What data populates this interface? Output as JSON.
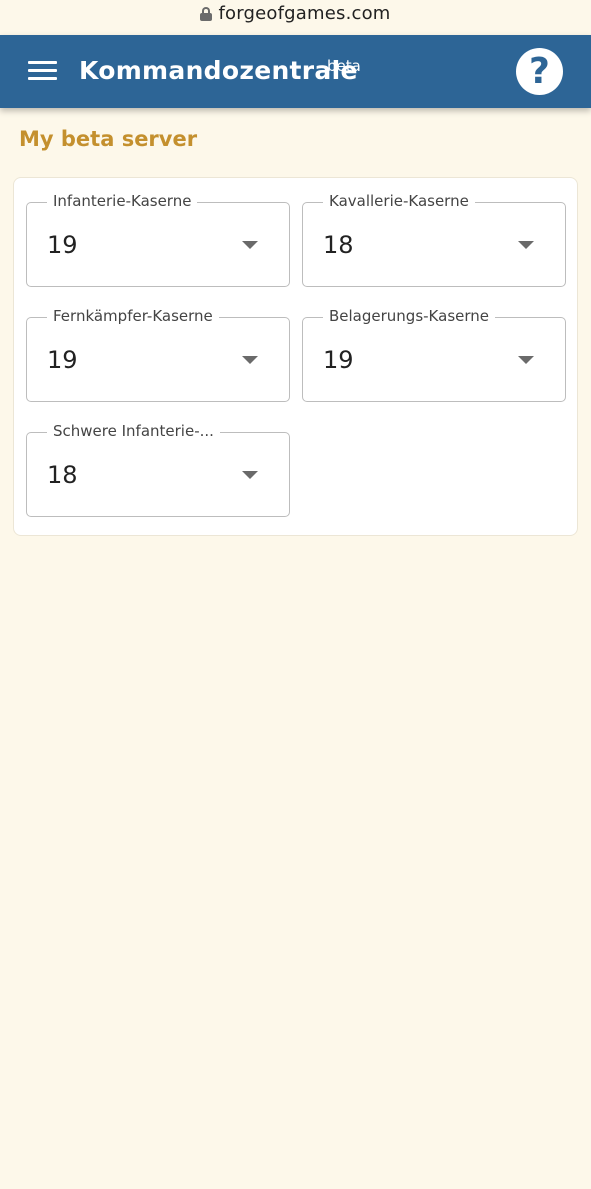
{
  "browser": {
    "url": "forgeofgames.com"
  },
  "header": {
    "title": "Kommandozentrale",
    "badge": "beta",
    "help_symbol": "?"
  },
  "server": {
    "name": "My beta server"
  },
  "barracks": [
    {
      "label": "Infanterie-Kaserne",
      "value": "19"
    },
    {
      "label": "Kavallerie-Kaserne",
      "value": "18"
    },
    {
      "label": "Fernkämpfer-Kaserne",
      "value": "19"
    },
    {
      "label": "Belagerungs-Kaserne",
      "value": "19"
    },
    {
      "label": "Schwere Infanterie-...",
      "value": "18"
    }
  ],
  "colors": {
    "appbar": "#2d6596",
    "accent_title": "#c4902e",
    "background": "#fdf8ea"
  },
  "icons": {
    "menu": "hamburger-menu-icon",
    "help": "help-circle-icon",
    "lock": "lock-icon",
    "dropdown": "triangle-down-icon"
  }
}
